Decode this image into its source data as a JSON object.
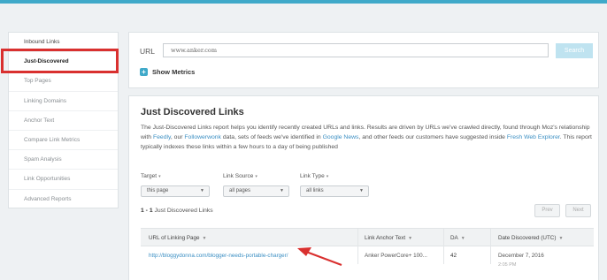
{
  "sidebar": {
    "items": [
      {
        "label": "Inbound Links"
      },
      {
        "label": "Just-Discovered"
      },
      {
        "label": "Top Pages"
      },
      {
        "label": "Linking Domains"
      },
      {
        "label": "Anchor Text"
      },
      {
        "label": "Compare Link Metrics"
      },
      {
        "label": "Spam Analysis"
      },
      {
        "label": "Link Opportunities"
      },
      {
        "label": "Advanced Reports"
      }
    ]
  },
  "url_panel": {
    "label": "URL",
    "value": "www.anker.com",
    "search_label": "Search",
    "show_metrics_label": "Show Metrics"
  },
  "main": {
    "title": "Just Discovered Links",
    "desc": {
      "p1": "The Just-Discovered Links report helps you identify recently created URLs and links. Results are driven by URLs we've crawled directly, found through Moz's relationship with ",
      "feedly": "Feedly",
      "p2": ", our ",
      "followerwonk": "Followerwonk",
      "p3": " data, sets of feeds we've identified in ",
      "google_news": "Google News",
      "p4": ", and other feeds our customers have suggested inside ",
      "fresh_web": "Fresh Web Explorer",
      "p5": ". This report typically indexes these links within a few hours to a day of being published"
    },
    "filters": {
      "target": {
        "label": "Target",
        "value": "this page"
      },
      "link_source": {
        "label": "Link Source",
        "value": "all pages"
      },
      "link_type": {
        "label": "Link Type",
        "value": "all links"
      }
    },
    "count": {
      "range": "1 - 1",
      "text": "Just Discovered Links"
    },
    "pager": {
      "prev": "Prev",
      "next": "Next"
    },
    "table": {
      "headers": {
        "url": "URL of Linking Page",
        "anchor": "Link Anchor Text",
        "da": "DA",
        "date": "Date Discovered (UTC)"
      },
      "rows": [
        {
          "url": "http://bloggydonna.com/blogger-needs-portable-charger/",
          "anchor": "Anker PowerCore+ 100...",
          "da": "42",
          "date": "December 7, 2016",
          "time": "2:05 PM"
        }
      ]
    }
  },
  "colors": {
    "accent": "#3fa9c9",
    "highlight": "#d9302f",
    "link": "#3b8fc3"
  }
}
